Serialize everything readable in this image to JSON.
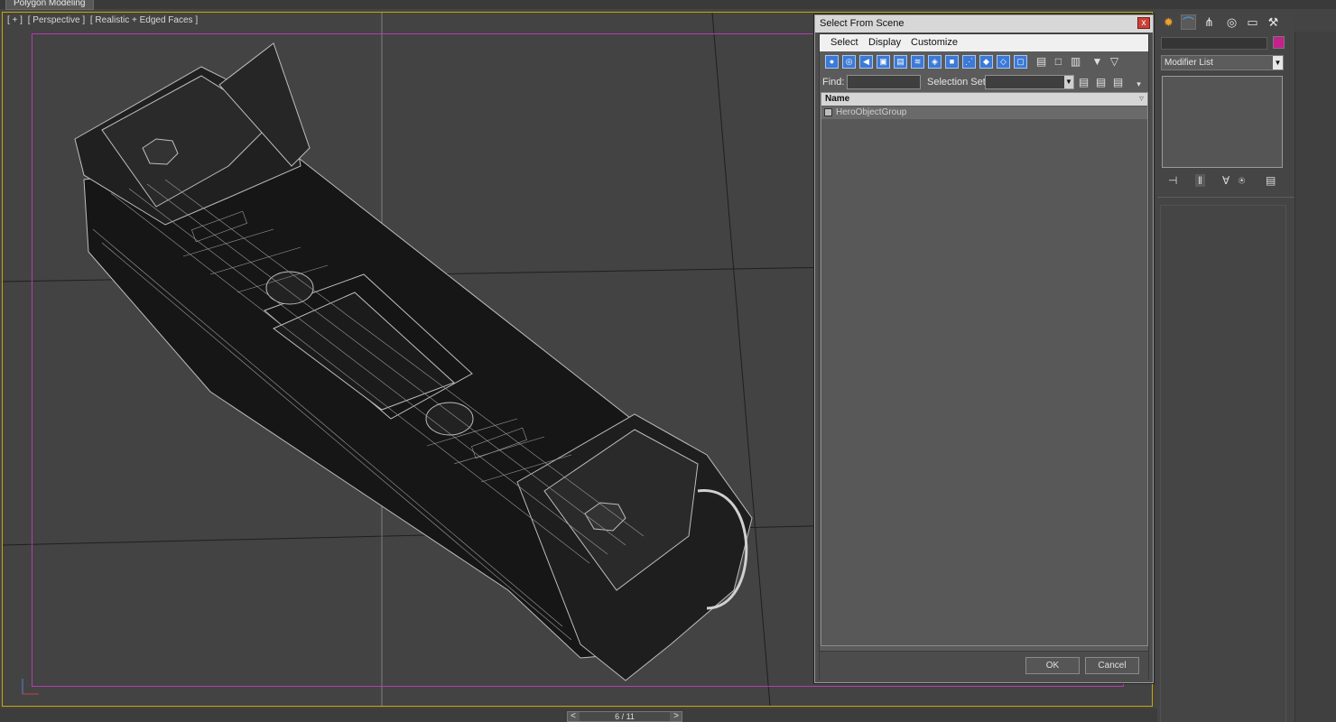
{
  "ribbon": {
    "tab_label": "Polygon Modeling"
  },
  "viewport": {
    "label_plus": "[ + ]",
    "label_view": "[ Perspective ]",
    "label_shading": "[ Realistic + Edged Faces ]"
  },
  "dialog": {
    "title": "Select From Scene",
    "close_glyph": "x",
    "menu": [
      "Select",
      "Display",
      "Customize"
    ],
    "find_label": "Find:",
    "find_value": "",
    "selection_set_label": "Selection Set:",
    "selection_set_value": "",
    "list_header": "Name",
    "rows": [
      {
        "name": "HeroObjectGroup"
      }
    ],
    "ok_label": "OK",
    "cancel_label": "Cancel"
  },
  "command_panel": {
    "tabs": [
      "create-icon",
      "modify-icon",
      "hierarchy-icon",
      "motion-icon",
      "display-icon",
      "utilities-icon"
    ],
    "name_value": "",
    "object_color": "#c4218a",
    "modifier_list_label": "Modifier List"
  },
  "time_slider": {
    "frame_text": "6 / 11",
    "prev_glyph": "<",
    "next_glyph": ">"
  },
  "colors": {
    "viewport_border": "#c9a700",
    "safe_frame": "#b43cb4",
    "toolbar_blue": "#3d7ad6"
  }
}
